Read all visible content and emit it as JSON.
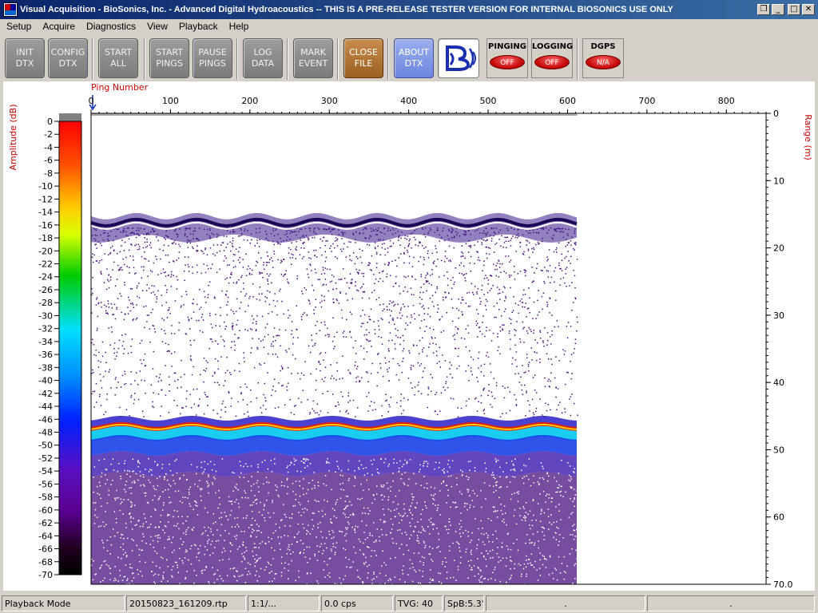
{
  "window": {
    "title": "Visual Acquisition  -  BioSonics, Inc.  -  Advanced Digital Hydroacoustics  -- THIS IS A PRE-RELEASE TESTER VERSION FOR INTERNAL BIOSONICS USE ONLY",
    "icon": "dt-app-icon",
    "controls": [
      "restore-icon",
      "minimize-icon",
      "maximize-icon",
      "close-icon"
    ]
  },
  "menu": [
    "Setup",
    "Acquire",
    "Diagnostics",
    "View",
    "Playback",
    "Help"
  ],
  "toolbar": {
    "buttons": [
      {
        "label": "INIT\nDTX",
        "style": "gray"
      },
      {
        "label": "CONFIG\nDTX",
        "style": "gray"
      },
      {
        "label": "START\nALL",
        "style": "gray"
      },
      {
        "label": "START\nPINGS",
        "style": "gray"
      },
      {
        "label": "PAUSE\nPINGS",
        "style": "gray"
      },
      {
        "label": "LOG\nDATA",
        "style": "gray"
      },
      {
        "label": "MARK\nEVENT",
        "style": "gray"
      },
      {
        "label": "CLOSE\nFILE",
        "style": "brown"
      },
      {
        "label": "ABOUT\nDTX",
        "style": "blue"
      }
    ],
    "logo_icon": "biosonics-logo-icon",
    "indicators": [
      {
        "label": "PINGING",
        "state": "OFF"
      },
      {
        "label": "LOGGING",
        "state": "OFF"
      },
      {
        "label": "DGPS",
        "state": "N/A"
      }
    ],
    "colors": {
      "gray": "#8a8a8a",
      "brown": "#b87a3a",
      "blue": "#8299e6",
      "lamp": "#e01010"
    }
  },
  "plot": {
    "ping_axis_title": "Ping Number",
    "ping_ticks": [
      "0",
      "100",
      "200",
      "300",
      "400",
      "500",
      "600",
      "700",
      "800"
    ],
    "ping_range": [
      0,
      850
    ],
    "pings_recorded": 612,
    "range_axis_title": "Range (m)",
    "range_ticks": [
      "0",
      "10",
      "20",
      "30",
      "40",
      "50",
      "60",
      "70.0"
    ],
    "range_max": 70,
    "amplitude_axis_title": "Amplitude (dB)",
    "amplitude_ticks": [
      "0",
      "-2",
      "-4",
      "-6",
      "-8",
      "-10",
      "-12",
      "-14",
      "-16",
      "-18",
      "-20",
      "-22",
      "-24",
      "-26",
      "-28",
      "-30",
      "-32",
      "-34",
      "-36",
      "-38",
      "-40",
      "-42",
      "-44",
      "-46",
      "-48",
      "-50",
      "-52",
      "-54",
      "-56",
      "-58",
      "-60",
      "-62",
      "-64",
      "-66",
      "-68",
      "-70"
    ],
    "echo_layers": {
      "surface_range_m": 16,
      "bottom_range_m": 46.5
    }
  },
  "statusbar": [
    "Playback Mode",
    "20150823_161209.rtp",
    "1:1/...",
    "0.0 cps",
    "TVG: 40",
    "SpB:5.3°",
    ".",
    "."
  ]
}
